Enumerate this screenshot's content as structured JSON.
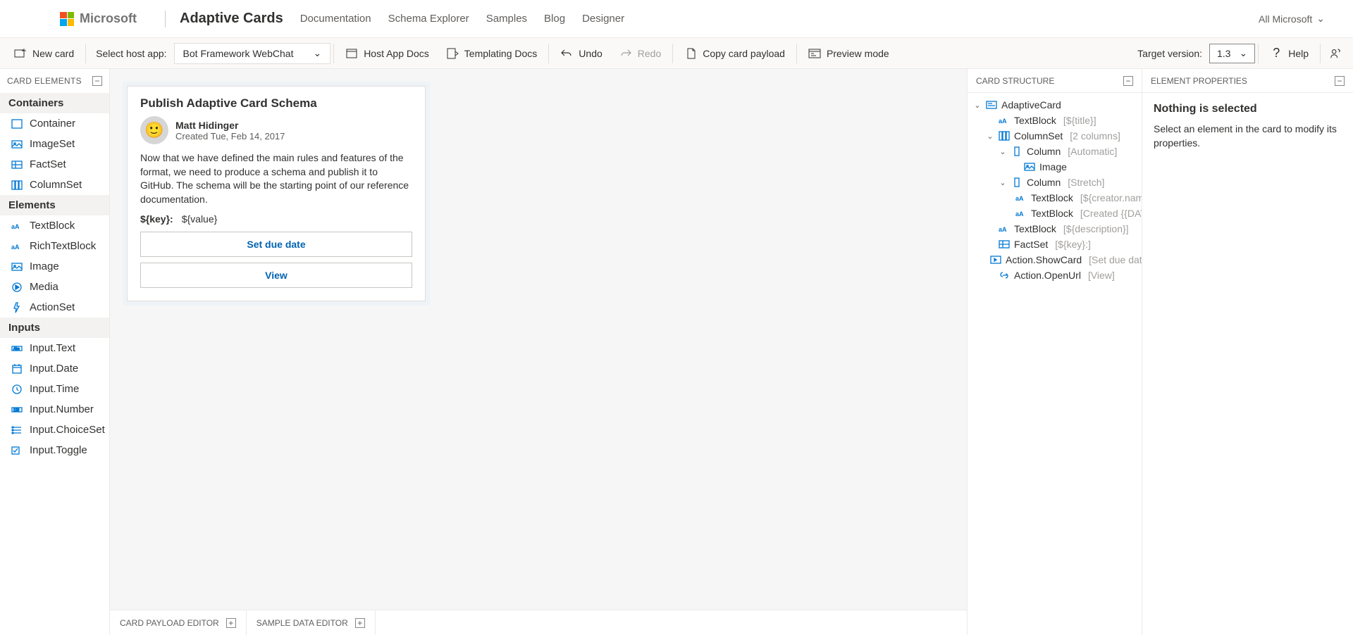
{
  "topnav": {
    "microsoft": "Microsoft",
    "brand": "Adaptive Cards",
    "links": [
      "Documentation",
      "Schema Explorer",
      "Samples",
      "Blog",
      "Designer"
    ],
    "allMicrosoft": "All Microsoft"
  },
  "toolbar": {
    "newCard": "New card",
    "selectHostApp": "Select host app:",
    "hostApp": "Bot Framework WebChat",
    "hostAppDocs": "Host App Docs",
    "templatingDocs": "Templating Docs",
    "undo": "Undo",
    "redo": "Redo",
    "copyPayload": "Copy card payload",
    "previewMode": "Preview mode",
    "targetVersion": "Target version:",
    "version": "1.3",
    "help": "Help"
  },
  "leftPanel": {
    "title": "CARD ELEMENTS",
    "groups": [
      {
        "name": "Containers",
        "items": [
          {
            "icon": "container",
            "label": "Container"
          },
          {
            "icon": "imageset",
            "label": "ImageSet"
          },
          {
            "icon": "factset",
            "label": "FactSet"
          },
          {
            "icon": "columnset",
            "label": "ColumnSet"
          }
        ]
      },
      {
        "name": "Elements",
        "items": [
          {
            "icon": "textblock",
            "label": "TextBlock"
          },
          {
            "icon": "textblock",
            "label": "RichTextBlock"
          },
          {
            "icon": "image",
            "label": "Image"
          },
          {
            "icon": "media",
            "label": "Media"
          },
          {
            "icon": "actionset",
            "label": "ActionSet"
          }
        ]
      },
      {
        "name": "Inputs",
        "items": [
          {
            "icon": "inputtext",
            "label": "Input.Text"
          },
          {
            "icon": "inputdate",
            "label": "Input.Date"
          },
          {
            "icon": "inputtime",
            "label": "Input.Time"
          },
          {
            "icon": "inputnumber",
            "label": "Input.Number"
          },
          {
            "icon": "inputchoice",
            "label": "Input.ChoiceSet"
          },
          {
            "icon": "inputtoggle",
            "label": "Input.Toggle"
          }
        ]
      }
    ]
  },
  "card": {
    "title": "Publish Adaptive Card Schema",
    "creatorName": "Matt Hidinger",
    "created": "Created Tue, Feb 14, 2017",
    "description": "Now that we have defined the main rules and features of the format, we need to produce a schema and publish it to GitHub. The schema will be the starting point of our reference documentation.",
    "factKey": "${key}:",
    "factValue": "${value}",
    "btn1": "Set due date",
    "btn2": "View"
  },
  "structure": {
    "title": "CARD STRUCTURE",
    "tree": [
      {
        "ind": 0,
        "chev": "down",
        "icon": "card",
        "name": "AdaptiveCard",
        "meta": ""
      },
      {
        "ind": 1,
        "chev": "",
        "icon": "textblock",
        "name": "TextBlock",
        "meta": "[${title}]"
      },
      {
        "ind": 1,
        "chev": "down",
        "icon": "columnset",
        "name": "ColumnSet",
        "meta": "[2 columns]"
      },
      {
        "ind": 2,
        "chev": "down",
        "icon": "column",
        "name": "Column",
        "meta": "[Automatic]"
      },
      {
        "ind": 3,
        "chev": "",
        "icon": "image",
        "name": "Image",
        "meta": ""
      },
      {
        "ind": 2,
        "chev": "down",
        "icon": "column",
        "name": "Column",
        "meta": "[Stretch]"
      },
      {
        "ind": 3,
        "chev": "",
        "icon": "textblock",
        "name": "TextBlock",
        "meta": "[${creator.name}]"
      },
      {
        "ind": 3,
        "chev": "",
        "icon": "textblock",
        "name": "TextBlock",
        "meta": "[Created {{DATE(${"
      },
      {
        "ind": 1,
        "chev": "",
        "icon": "textblock",
        "name": "TextBlock",
        "meta": "[${description}]"
      },
      {
        "ind": 1,
        "chev": "",
        "icon": "factset",
        "name": "FactSet",
        "meta": "[${key}:]"
      },
      {
        "ind": 1,
        "chev": "",
        "icon": "showcard",
        "name": "Action.ShowCard",
        "meta": "[Set due date"
      },
      {
        "ind": 1,
        "chev": "",
        "icon": "openurl",
        "name": "Action.OpenUrl",
        "meta": "[View]"
      }
    ]
  },
  "properties": {
    "title": "ELEMENT PROPERTIES",
    "heading": "Nothing is selected",
    "text": "Select an element in the card to modify its properties."
  },
  "bottomTabs": {
    "tab1": "CARD PAYLOAD EDITOR",
    "tab2": "SAMPLE DATA EDITOR"
  }
}
